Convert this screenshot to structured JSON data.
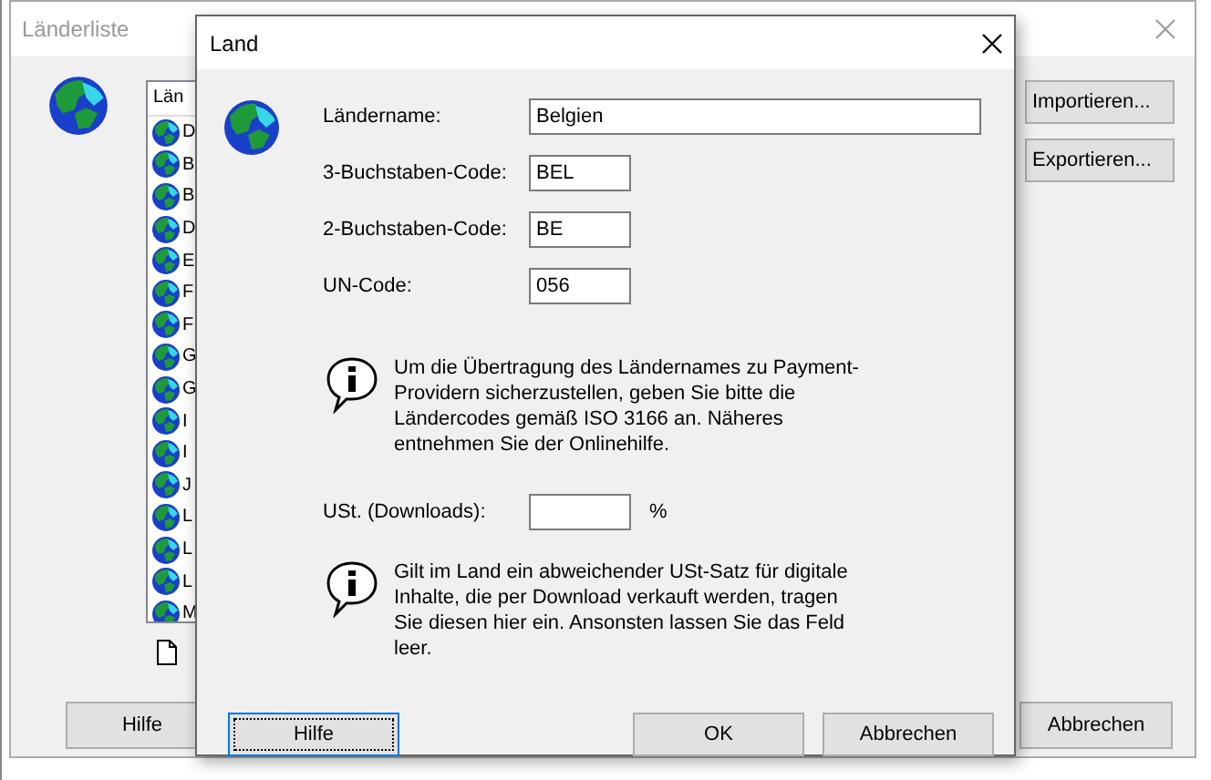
{
  "background_window": {
    "title": "Länderliste",
    "list": {
      "column": "Län",
      "items": [
        "D",
        "B",
        "B",
        "D",
        "E",
        "F",
        "F",
        "G",
        "G",
        "I",
        "I",
        "J",
        "L",
        "L",
        "L",
        "M"
      ]
    },
    "buttons": [
      "Importieren...",
      "Exportieren..."
    ],
    "footer_buttons": [
      "Hilfe",
      "Abbrechen"
    ]
  },
  "dialog": {
    "title": "Land",
    "fields": [
      {
        "label": "Ländername:",
        "value": "Belgien",
        "kind": "wide"
      },
      {
        "label": "3-Buchstaben-Code:",
        "value": "BEL",
        "kind": "short"
      },
      {
        "label": "2-Buchstaben-Code:",
        "value": "BE",
        "kind": "short"
      },
      {
        "label": "UN-Code:",
        "value": "056",
        "kind": "short"
      }
    ],
    "info_1": "Um die Übertragung des Ländernames zu Payment-Providern sicherzustellen, geben Sie bitte die Ländercodes gemäß ISO 3166 an. Näheres entnehmen Sie der Onlinehilfe.",
    "vat": {
      "label": "USt. (Downloads):",
      "unit": "%"
    },
    "info_2": "Gilt im Land ein abweichender USt-Satz für digitale Inhalte, die per Download verkauft werden, tragen Sie diesen hier ein. Ansonsten lassen Sie das Feld leer.",
    "buttons": [
      {
        "label": "Hilfe",
        "focused": true
      },
      {
        "label": "OK",
        "focused": false
      },
      {
        "label": "Abbrechen",
        "focused": false
      }
    ]
  }
}
